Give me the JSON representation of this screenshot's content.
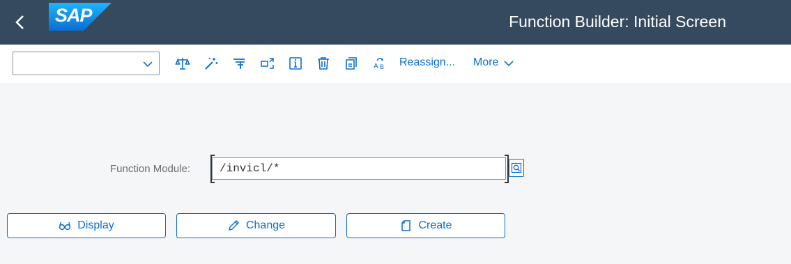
{
  "header": {
    "logo_text": "SAP",
    "title": "Function Builder: Initial Screen"
  },
  "toolbar": {
    "combo_value": "",
    "icons": [
      "balance-icon",
      "magic-wand-icon",
      "where-used-icon",
      "test-icon",
      "info-icon",
      "delete-icon",
      "copy-icon",
      "rename-icon"
    ],
    "reassign_label": "Reassign...",
    "more_label": "More"
  },
  "form": {
    "function_module_label": "Function Module:",
    "function_module_value": "/invicl/*"
  },
  "actions": {
    "display_label": "Display",
    "change_label": "Change",
    "create_label": "Create"
  },
  "colors": {
    "shell": "#354a5f",
    "accent": "#0a6ed1",
    "background": "#f5f6f7"
  }
}
